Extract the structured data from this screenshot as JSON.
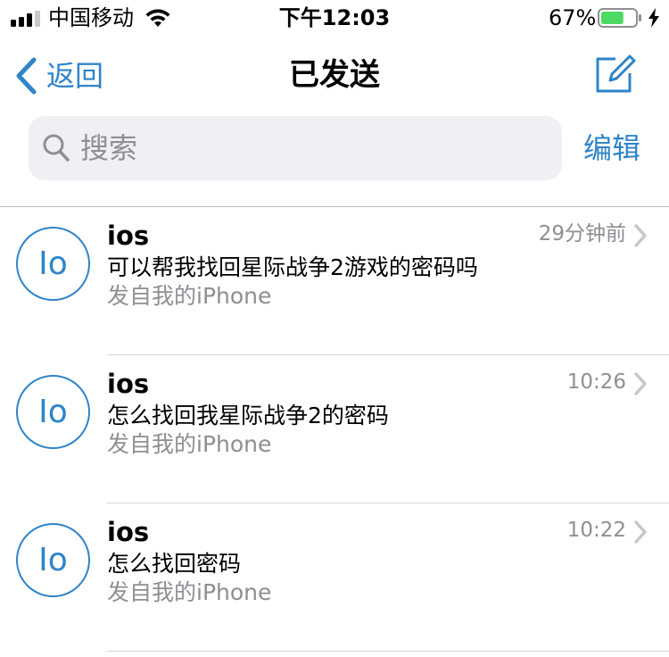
{
  "status_bar": {
    "carrier": "中国移动",
    "time": "下午12:03",
    "battery_percent": "67%",
    "battery_level": 0.67,
    "signal_bars": 3,
    "battery_color": "#4cd964",
    "icons": [
      "signal-icon",
      "wifi-icon",
      "battery-icon",
      "charging-bolt-icon"
    ]
  },
  "nav": {
    "back_label": "返回",
    "title": "已发送",
    "compose_icon": "compose-icon",
    "accent_color": "#2f84c8"
  },
  "search": {
    "placeholder": "搜索",
    "value": "",
    "edit_label": "编辑"
  },
  "messages": [
    {
      "avatar_initials": "Io",
      "sender": "ios",
      "time": "29分钟前",
      "subject": "可以帮我找回星际战争2游戏的密码吗",
      "preview": "发自我的iPhone"
    },
    {
      "avatar_initials": "Io",
      "sender": "ios",
      "time": "10:26",
      "subject": "怎么找回我星际战争2的密码",
      "preview": "发自我的iPhone"
    },
    {
      "avatar_initials": "Io",
      "sender": "ios",
      "time": "10:22",
      "subject": "怎么找回密码",
      "preview": "发自我的iPhone"
    }
  ]
}
